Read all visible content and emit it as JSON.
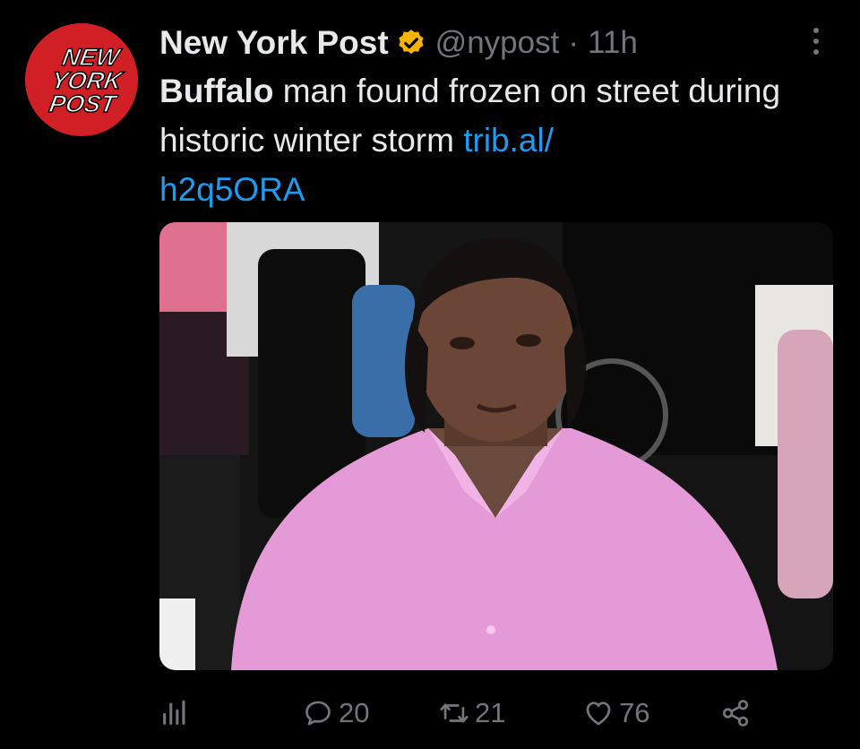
{
  "author": {
    "name": "New York Post",
    "handle": "@nypost",
    "separator": "·",
    "time": "11h",
    "verified_color": "#f4b400",
    "avatar_logo_lines": [
      "NEW",
      "YORK",
      "POST"
    ],
    "avatar_color": "#d11f26"
  },
  "tweet": {
    "bold_text": "Buffalo",
    "text": " man found frozen on street during historic winter storm ",
    "link_part1": "trib.al/",
    "link_part2": "h2q5ORA",
    "link_color": "#1d9bf0"
  },
  "media": {
    "description_icon": "photo"
  },
  "actions": {
    "views_icon": "analytics-icon",
    "replies": "20",
    "retweets": "21",
    "likes": "76",
    "share_icon": "share-icon"
  },
  "colors": {
    "background": "#000000",
    "text": "#e7e9ea",
    "muted": "#71767b"
  }
}
